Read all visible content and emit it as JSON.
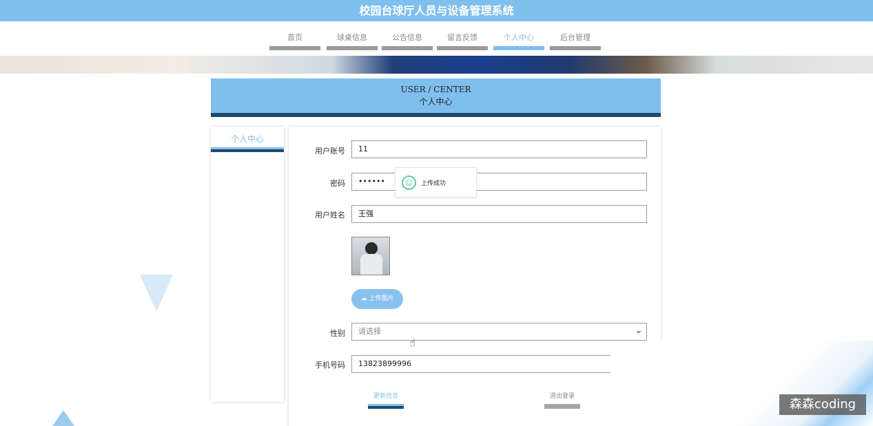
{
  "app": {
    "title": "校园台球厅人员与设备管理系统"
  },
  "nav": {
    "items": [
      {
        "label": "首页"
      },
      {
        "label": "球桌信息"
      },
      {
        "label": "公告信息"
      },
      {
        "label": "留言反馈"
      },
      {
        "label": "个人中心",
        "active": true
      },
      {
        "label": "后台管理"
      }
    ]
  },
  "header": {
    "en": "USER / CENTER",
    "cn": "个人中心"
  },
  "sidebar": {
    "title": "个人中心"
  },
  "form": {
    "account_label": "用户账号",
    "account_value": "11",
    "password_label": "密码",
    "password_value": "••••••",
    "name_label": "用户姓名",
    "name_value": "王强",
    "upload_label": "上传图片",
    "gender_label": "性别",
    "gender_placeholder": "请选择",
    "phone_label": "手机号码",
    "phone_value": "13823899996"
  },
  "actions": {
    "update": "更新信息",
    "logout": "退出登录"
  },
  "toast": {
    "message": "上传成功"
  },
  "watermark": {
    "text": "森森coding"
  },
  "colors": {
    "primary": "#7fbfee",
    "dark": "#1d4a6d",
    "success": "#5fc9a6"
  }
}
